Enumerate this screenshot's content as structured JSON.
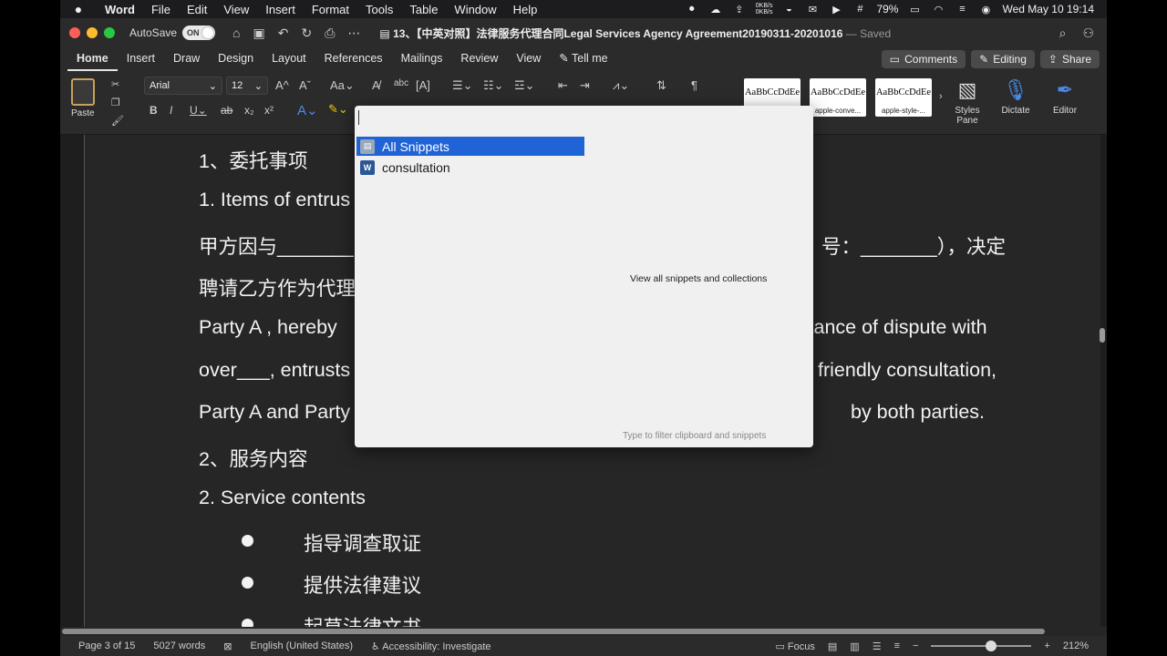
{
  "menubar": {
    "app": "Word",
    "items": [
      "File",
      "Edit",
      "View",
      "Insert",
      "Format",
      "Tools",
      "Table",
      "Window",
      "Help"
    ],
    "net_up": "0KB/s",
    "net_down": "0KB/s",
    "battery": "79%",
    "datetime": "Wed May 10  19:14"
  },
  "titlebar": {
    "autosave_label": "AutoSave",
    "autosave_state": "ON",
    "doc_title": "13、【中英对照】法律服务代理合同Legal Services Agency Agreement20190311-20201016",
    "saved_label": "— Saved"
  },
  "tabs": [
    "Home",
    "Insert",
    "Draw",
    "Design",
    "Layout",
    "References",
    "Mailings",
    "Review",
    "View"
  ],
  "tell_me": "Tell me",
  "actions": {
    "comments": "Comments",
    "editing": "Editing",
    "share": "Share"
  },
  "ribbon": {
    "paste_label": "Paste",
    "font_name": "Arial",
    "font_size": "12",
    "styles": [
      {
        "preview": "AaBbCcDdEe",
        "name": ""
      },
      {
        "preview": "AaBbCcDdEe",
        "name": "apple-conve..."
      },
      {
        "preview": "AaBbCcDdEe",
        "name": "apple-style-..."
      }
    ],
    "styles_pane": "Styles Pane",
    "dictate": "Dictate",
    "editor": "Editor"
  },
  "document": {
    "lines": [
      "1、委托事项",
      "1. Items of entrus",
      "甲方因与",
      "聘请乙方作为代理",
      "Party A , hereby",
      "over___, entrusts",
      "Party A and Party",
      "2、服务内容",
      "2. Service contents"
    ],
    "right_fragments": [
      "号：_______），决定",
      "istance of dispute with",
      "friendly consultation,",
      "by both parties."
    ],
    "bullets": [
      "指导调查取证",
      "提供法律建议",
      "起草法律文书"
    ]
  },
  "snippets_popup": {
    "items": [
      {
        "label": "All Snippets",
        "selected": true
      },
      {
        "label": "consultation",
        "selected": false
      }
    ],
    "view_all": "View all snippets and collections",
    "filter_hint": "Type to filter clipboard and snippets"
  },
  "statusbar": {
    "page": "Page 3 of 15",
    "words": "5027 words",
    "language": "English (United States)",
    "accessibility": "Accessibility: Investigate",
    "focus": "Focus",
    "zoom": "212%"
  },
  "colors": {
    "selection": "#1f63d6",
    "close": "#ff5f57",
    "minimize": "#febc2e",
    "zoom": "#28c840"
  }
}
